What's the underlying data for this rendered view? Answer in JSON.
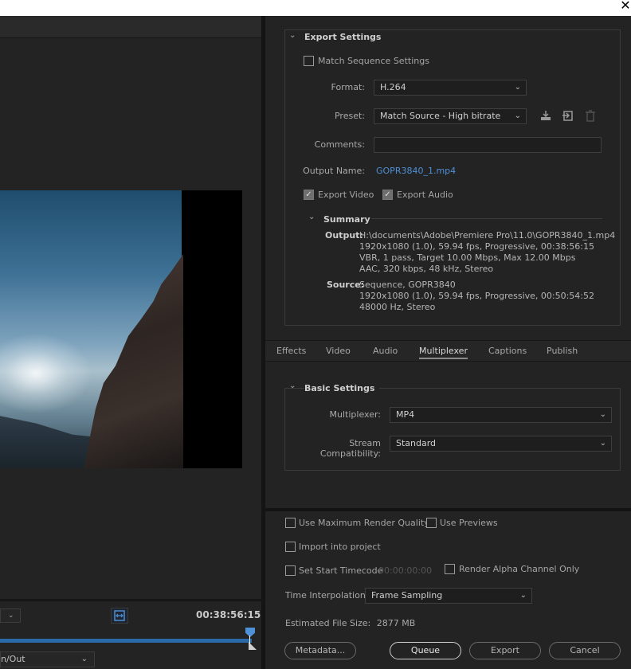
{
  "window": {
    "close_glyph": "✕"
  },
  "left": {
    "mini_select_arrow": "⌄",
    "timecode": "00:38:56:15",
    "range_select": {
      "value": "n/Out",
      "arrow": "⌄"
    }
  },
  "export_settings": {
    "title": "Export Settings",
    "match_sequence_label": "Match Sequence Settings",
    "format_label": "Format:",
    "format_value": "H.264",
    "preset_label": "Preset:",
    "preset_value": "Match Source - High bitrate",
    "comments_label": "Comments:",
    "comments_value": "",
    "output_name_label": "Output Name:",
    "output_name_value": "GOPR3840_1.mp4",
    "export_video_label": "Export Video",
    "export_audio_label": "Export Audio",
    "icons": [
      "save-preset-icon",
      "import-preset-icon",
      "delete-preset-icon"
    ]
  },
  "summary": {
    "title": "Summary",
    "output_label": "Output:",
    "output_lines": [
      "H:\\documents\\Adobe\\Premiere Pro\\11.0\\GOPR3840_1.mp4",
      "1920x1080 (1.0), 59.94 fps, Progressive, 00:38:56:15",
      "VBR, 1 pass, Target 10.00 Mbps, Max 12.00 Mbps",
      "AAC, 320 kbps, 48 kHz, Stereo"
    ],
    "source_label": "Source:",
    "source_lines": [
      "Sequence, GOPR3840",
      "1920x1080 (1.0), 59.94 fps, Progressive, 00:50:54:52",
      "48000 Hz, Stereo"
    ]
  },
  "tabs": [
    "Effects",
    "Video",
    "Audio",
    "Multiplexer",
    "Captions",
    "Publish"
  ],
  "active_tab": "Multiplexer",
  "basic_settings": {
    "title": "Basic Settings",
    "multiplexer_label": "Multiplexer:",
    "multiplexer_value": "MP4",
    "stream_label": "Stream Compatibility:",
    "stream_value": "Standard"
  },
  "render": {
    "max_quality_label": "Use Maximum Render Quality",
    "use_previews_label": "Use Previews",
    "import_label": "Import into project",
    "start_timecode_label": "Set Start Timecode",
    "start_timecode_value": "00:00:00:00",
    "alpha_label": "Render Alpha Channel Only",
    "interp_label": "Time Interpolation:",
    "interp_value": "Frame Sampling",
    "filesize_label": "Estimated File Size:",
    "filesize_value": "2877 MB"
  },
  "buttons": {
    "metadata": "Metadata...",
    "queue": "Queue",
    "export": "Export",
    "cancel": "Cancel"
  },
  "colors": {
    "accent": "#2b6aa8",
    "link": "#4e8fd6",
    "panel": "#232323"
  }
}
